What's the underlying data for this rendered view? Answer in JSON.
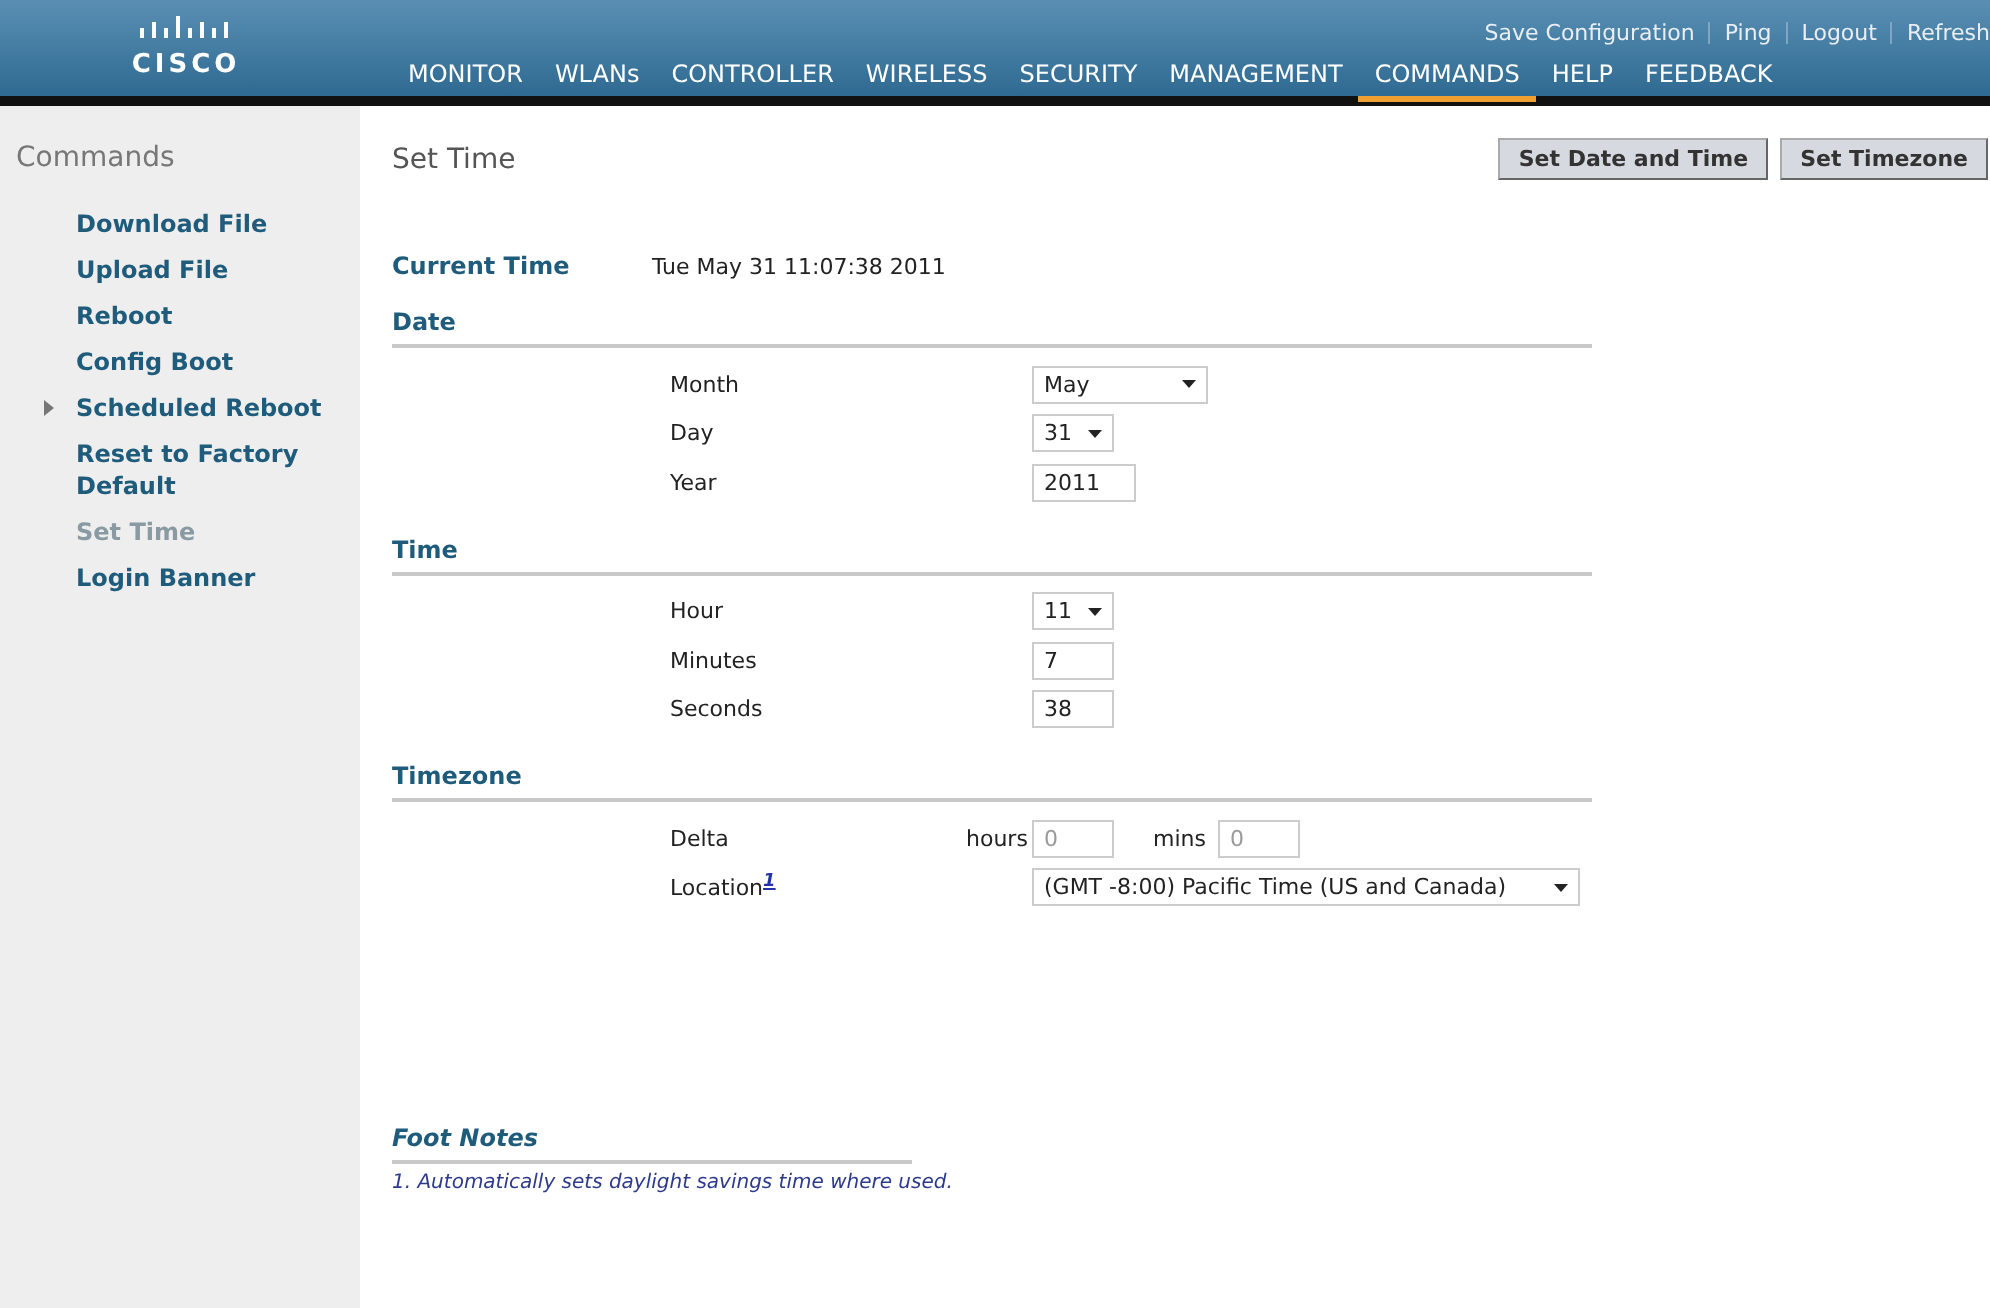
{
  "header": {
    "logo_text": "CISCO",
    "top_links": [
      "Save Configuration",
      "Ping",
      "Logout",
      "Refresh"
    ],
    "nav": [
      {
        "label": "MONITOR",
        "selected": false
      },
      {
        "label": "WLANs",
        "selected": false
      },
      {
        "label": "CONTROLLER",
        "selected": false
      },
      {
        "label": "WIRELESS",
        "selected": false
      },
      {
        "label": "SECURITY",
        "selected": false
      },
      {
        "label": "MANAGEMENT",
        "selected": false
      },
      {
        "label": "COMMANDS",
        "selected": true
      },
      {
        "label": "HELP",
        "selected": false
      },
      {
        "label": "FEEDBACK",
        "selected": false
      }
    ]
  },
  "sidebar": {
    "title": "Commands",
    "items": [
      {
        "label": "Download File",
        "kind": "link",
        "selected": false
      },
      {
        "label": "Upload File",
        "kind": "link",
        "selected": false
      },
      {
        "label": "Reboot",
        "kind": "link",
        "selected": false
      },
      {
        "label": "Config Boot",
        "kind": "link",
        "selected": false
      },
      {
        "label": "Scheduled Reboot",
        "kind": "group",
        "expanded": false,
        "selected": false
      },
      {
        "label": "Reset to Factory Default",
        "kind": "link",
        "selected": false
      },
      {
        "label": "Set Time",
        "kind": "link",
        "selected": true
      },
      {
        "label": "Login Banner",
        "kind": "link",
        "selected": false
      }
    ]
  },
  "page": {
    "title": "Set Time",
    "buttons": [
      "Set Date and Time",
      "Set Timezone"
    ],
    "current_time": {
      "label": "Current Time",
      "value": "Tue May 31 11:07:38 2011"
    },
    "sections": [
      {
        "title": "Date",
        "rows": [
          {
            "kind": "select",
            "label": "Month",
            "value": "May"
          },
          {
            "kind": "select",
            "label": "Day",
            "value": "31"
          },
          {
            "kind": "text",
            "label": "Year",
            "value": "2011"
          }
        ]
      },
      {
        "title": "Time",
        "rows": [
          {
            "kind": "select",
            "label": "Hour",
            "value": "11"
          },
          {
            "kind": "text",
            "label": "Minutes",
            "value": "7"
          },
          {
            "kind": "text",
            "label": "Seconds",
            "value": "38"
          }
        ]
      },
      {
        "title": "Timezone",
        "rows": [
          {
            "kind": "delta",
            "label": "Delta",
            "fields": [
              {
                "label": "hours",
                "placeholder": "0"
              },
              {
                "label": "mins",
                "placeholder": "0"
              }
            ]
          },
          {
            "kind": "select",
            "label": "Location$^{1}$",
            "value": "(GMT -8:00) Pacific Time (US and Canada)"
          }
        ]
      }
    ],
    "footnotes": {
      "title": "Foot Notes",
      "items": [
        "1. Automatically sets daylight savings time where used."
      ]
    }
  }
}
